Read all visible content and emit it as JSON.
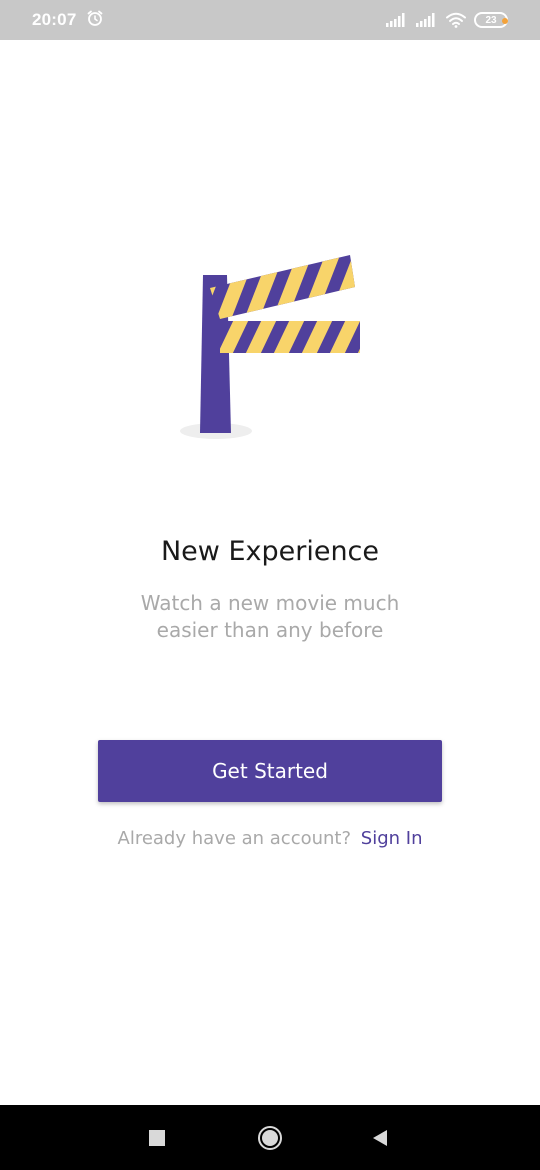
{
  "status_bar": {
    "time": "20:07",
    "battery_level": "23",
    "icons": [
      "alarm-icon",
      "signal-icon",
      "signal-icon",
      "wifi-icon",
      "battery-icon"
    ]
  },
  "illustration": {
    "name": "road-barrier-illustration",
    "colors": {
      "post": "#50409c",
      "stripe_yellow": "#f8d46a",
      "stripe_purple": "#50409c",
      "shadow": "#eeeeee"
    }
  },
  "onboarding": {
    "title": "New Experience",
    "subtitle_line1": "Watch a new movie much",
    "subtitle_line2": "easier than any before"
  },
  "actions": {
    "get_started_label": "Get Started",
    "signin_prompt": "Already have an account?",
    "signin_link": "Sign In"
  },
  "nav_bar": {
    "icons": [
      "recent-apps-icon",
      "home-icon",
      "back-icon"
    ]
  },
  "colors": {
    "accent": "#50409c",
    "muted_text": "#a9a9a9",
    "title_text": "#1a1a1a",
    "status_bar": "#c8c8c8"
  }
}
